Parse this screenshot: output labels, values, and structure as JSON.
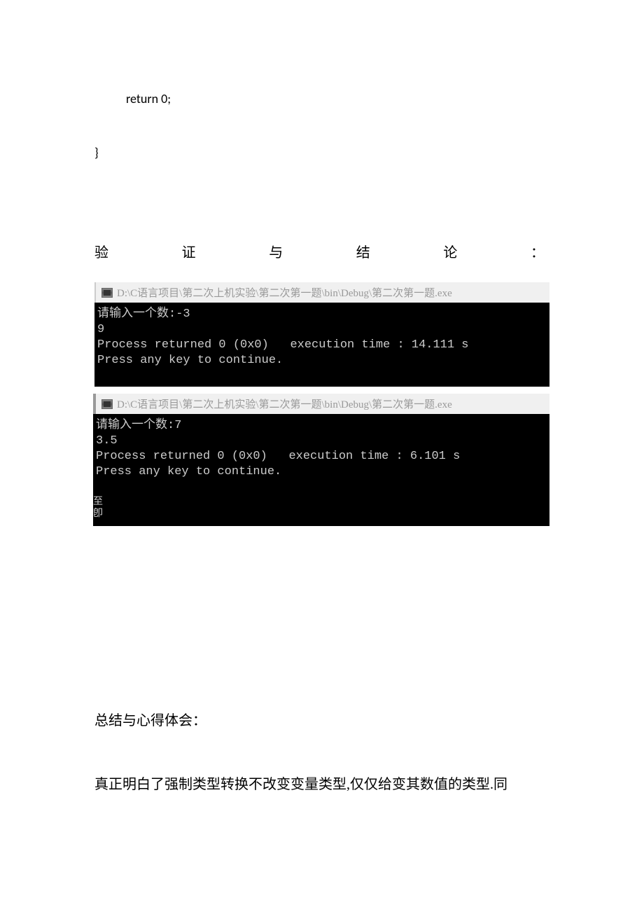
{
  "code": {
    "return_stmt": "return 0;",
    "closing_brace": "}"
  },
  "section": {
    "chars": [
      "验",
      "证",
      "与",
      "结",
      "论",
      "："
    ]
  },
  "console1": {
    "title": "D:\\C语言项目\\第二次上机实验\\第二次第一题\\bin\\Debug\\第二次第一题.exe",
    "line1": "请输入一个数:-3",
    "line2": "9",
    "line3": "Process returned 0 (0x0)   execution time : 14.111 s",
    "line4": "Press any key to continue."
  },
  "console2": {
    "title": "D:\\C语言项目\\第二次上机实验\\第二次第一题\\bin\\Debug\\第二次第一题.exe",
    "line1": "请输入一个数:7",
    "line2": "3.5",
    "line3": "Process returned 0 (0x0)   execution time : 6.101 s",
    "line4": "Press any key to continue.",
    "sidemark1": "至",
    "sidemark2": "卽"
  },
  "summary": {
    "heading": "总结与心得体会：",
    "body": "真正明白了强制类型转换不改变变量类型,仅仅给变其数值的类型.同"
  }
}
